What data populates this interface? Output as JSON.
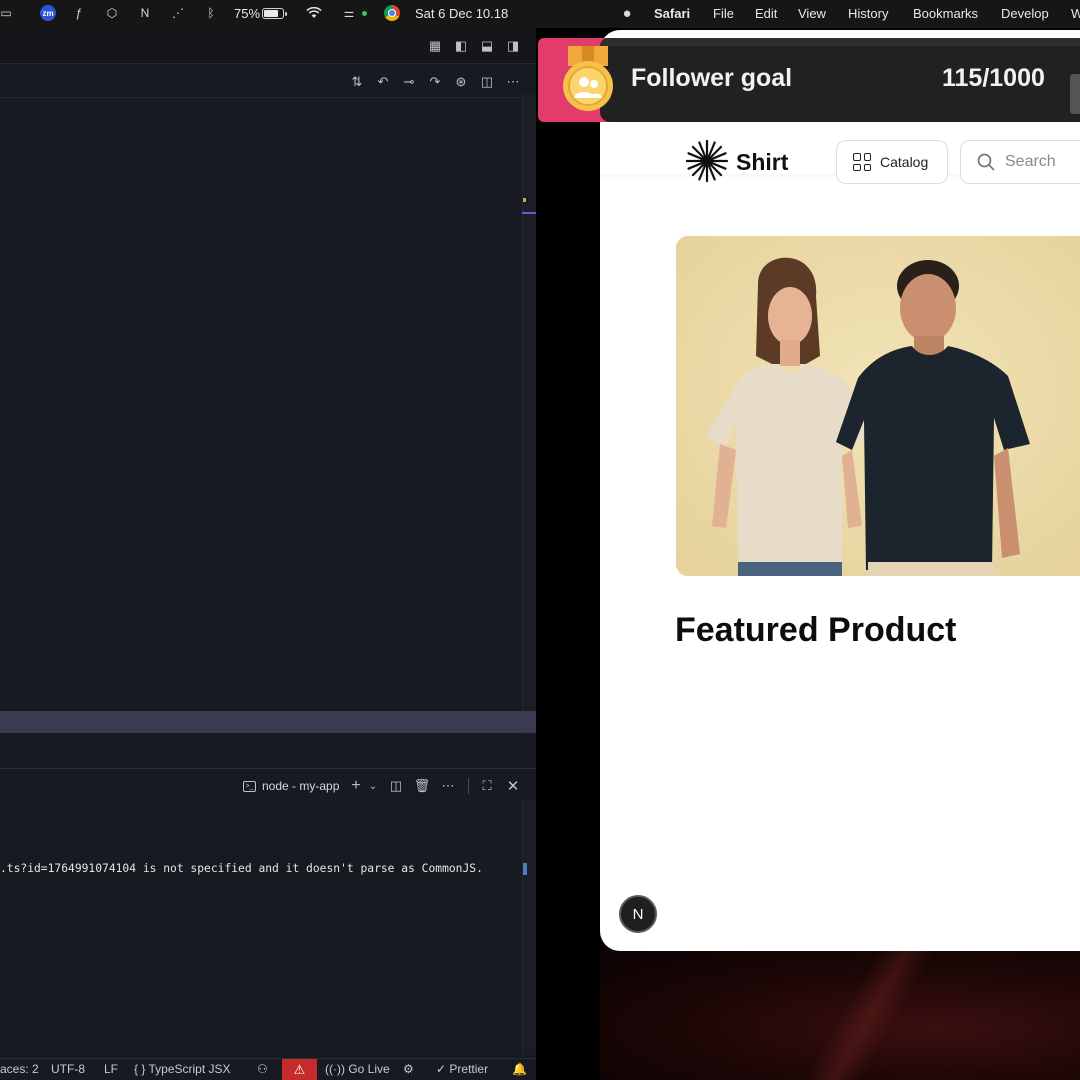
{
  "menubar": {
    "battery_percent": "75%",
    "battery_level": 0.75,
    "datetime": "Sat 6 Dec  10.18",
    "app_name": "Safari",
    "menus": [
      "File",
      "Edit",
      "View",
      "History",
      "Bookmarks",
      "Develop",
      "W"
    ]
  },
  "editor": {
    "terminal": {
      "title": "node - my-app",
      "output_line": ".ts?id=1764991074104 is not specified and it doesn't parse as CommonJS."
    },
    "statusbar": {
      "spaces": "aces: 2",
      "encoding": "UTF-8",
      "eol": "LF",
      "language": "TypeScript JSX",
      "language_braces": "{ }",
      "go_live": "Go Live",
      "formatter": "Prettier"
    }
  },
  "overlay": {
    "label": "Follower goal",
    "count": "115/1000",
    "progress": 0.115
  },
  "site": {
    "logo": "Shirt",
    "catalog_label": "Catalog",
    "search_placeholder": "Search",
    "featured_heading": "Featured Product",
    "dev_badge": "N"
  },
  "colors": {
    "editor_bg": "#181a21",
    "overlay_pink": "#e23c6c",
    "hero_bg": "#ecdcaa",
    "warning_red": "#c42b2b"
  }
}
